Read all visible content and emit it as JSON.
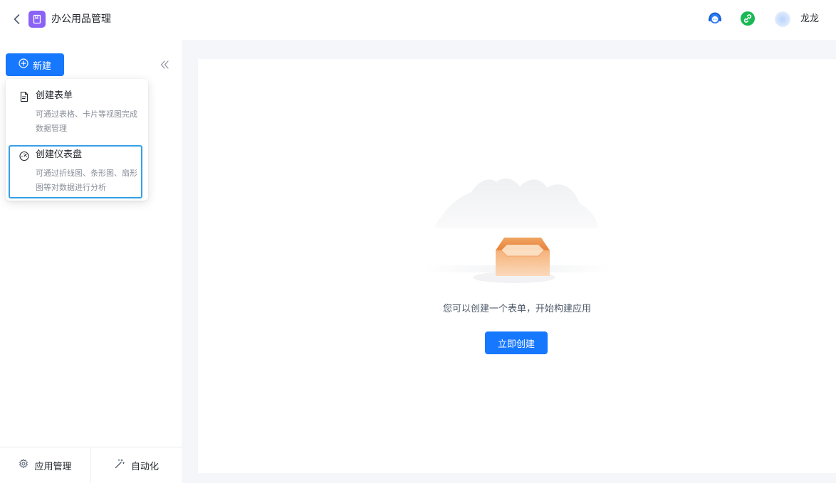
{
  "header": {
    "app_title": "办公用品管理",
    "user_name": "龙龙",
    "icons": [
      "back-icon",
      "app-icon",
      "support-icon",
      "link-icon",
      "avatar"
    ]
  },
  "sidebar": {
    "new_button_label": "新建",
    "new_menu": [
      {
        "title": "创建表单",
        "desc": "可通过表格、卡片等视图完成数据管理",
        "icon": "form-document-icon"
      },
      {
        "title": "创建仪表盘",
        "desc": "可通过折线图、条形图、扇形图等对数据进行分析",
        "icon": "dashboard-icon"
      }
    ],
    "footer": {
      "app_manage_label": "应用管理",
      "automation_label": "自动化"
    }
  },
  "main": {
    "empty_text": "您可以创建一个表单，开始构建应用",
    "create_now_label": "立即创建"
  },
  "colors": {
    "primary": "#1677ff",
    "app_icon": "#8a63f6",
    "highlight_border": "#35a0e6",
    "main_bg": "#f5f6fa"
  }
}
